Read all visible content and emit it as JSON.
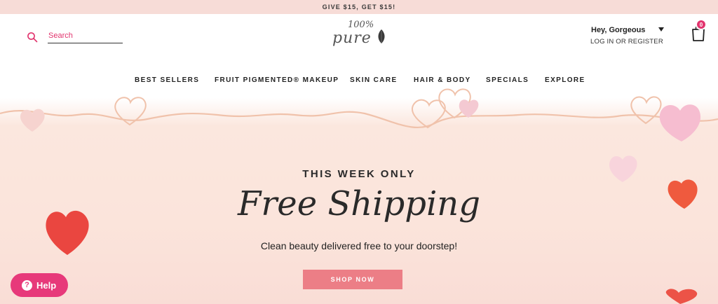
{
  "promo": {
    "text": "GIVE $15, GET $15!"
  },
  "search": {
    "placeholder": "Search",
    "value": ""
  },
  "logo": {
    "top": "100%",
    "bottom": "pure"
  },
  "account": {
    "greeting": "Hey, Gorgeous",
    "links": "LOG IN OR REGISTER"
  },
  "cart": {
    "count": "0"
  },
  "nav": {
    "items": [
      {
        "label": "BEST SELLERS"
      },
      {
        "label": "FRUIT PIGMENTED® MAKEUP"
      },
      {
        "label": "SKIN CARE"
      },
      {
        "label": "HAIR & BODY"
      },
      {
        "label": "SPECIALS"
      },
      {
        "label": "EXPLORE"
      }
    ]
  },
  "hero": {
    "kicker": "THIS WEEK ONLY",
    "title": "Free Shipping",
    "subtitle": "Clean beauty delivered free to your doorstep!",
    "cta": "SHOP NOW"
  },
  "help": {
    "label": "Help",
    "icon_glyph": "?"
  },
  "colors": {
    "accent": "#e2346e",
    "cta": "#ec7e86",
    "promo_bg": "#f7dcd7",
    "hero_bg": "#fbe4db"
  }
}
